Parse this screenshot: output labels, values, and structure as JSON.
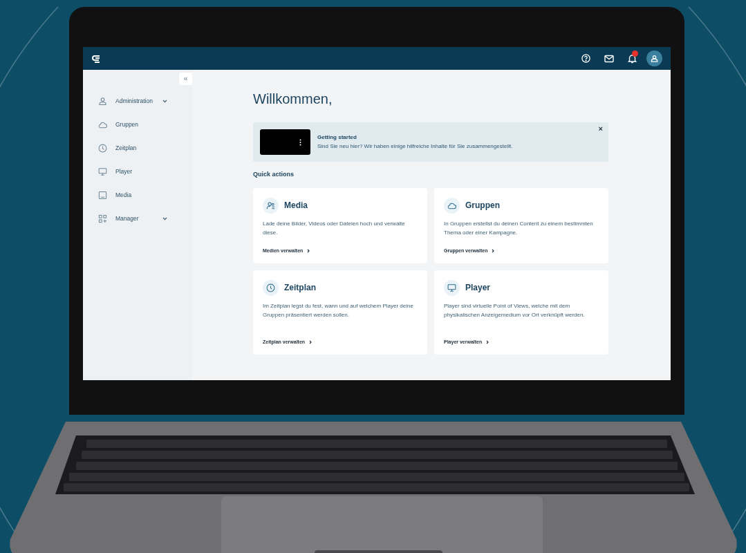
{
  "sidebar": {
    "collapse_label": "«",
    "items": [
      {
        "kind": "user",
        "label": "Administration",
        "has_submenu": true
      },
      {
        "kind": "cloud",
        "label": "Gruppen",
        "has_submenu": false
      },
      {
        "kind": "clock",
        "label": "Zeitplan",
        "has_submenu": false
      },
      {
        "kind": "monitor",
        "label": "Player",
        "has_submenu": false
      },
      {
        "kind": "image",
        "label": "Media",
        "has_submenu": false
      },
      {
        "kind": "grid",
        "label": "Manager",
        "has_submenu": true
      }
    ]
  },
  "main": {
    "title": "Willkommen,",
    "banner": {
      "title": "Getting started",
      "text": "Sind Sie neu hier? Wir haben einige hilfreiche Inhalte für Sie zusammengestellt.",
      "close_label": "×"
    },
    "quick_actions_heading": "Quick actions",
    "cards": [
      {
        "kind": "users",
        "title": "Media",
        "text": "Lade deine Bilder, Videos oder Dateien hoch und verwalte diese.",
        "link": "Medien verwalten"
      },
      {
        "kind": "cloud",
        "title": "Gruppen",
        "text": "In Gruppen erstellst du deinen Content zu einem bestimmten Thema oder einer Kampagne.",
        "link": "Gruppen verwalten"
      },
      {
        "kind": "clock",
        "title": "Zeitplan",
        "text": "Im Zeitplan legst du fest, wann und auf welchem Player deine Gruppen präsentiert werden sollen.",
        "link": "Zeitplan verwalten"
      },
      {
        "kind": "monitor",
        "title": "Player",
        "text": "Player sind virtuelle Point of Views, welche mit dem physikalischen Anzeigemedium vor Ort verknüpft werden.",
        "link": "Player verwalten"
      }
    ]
  }
}
